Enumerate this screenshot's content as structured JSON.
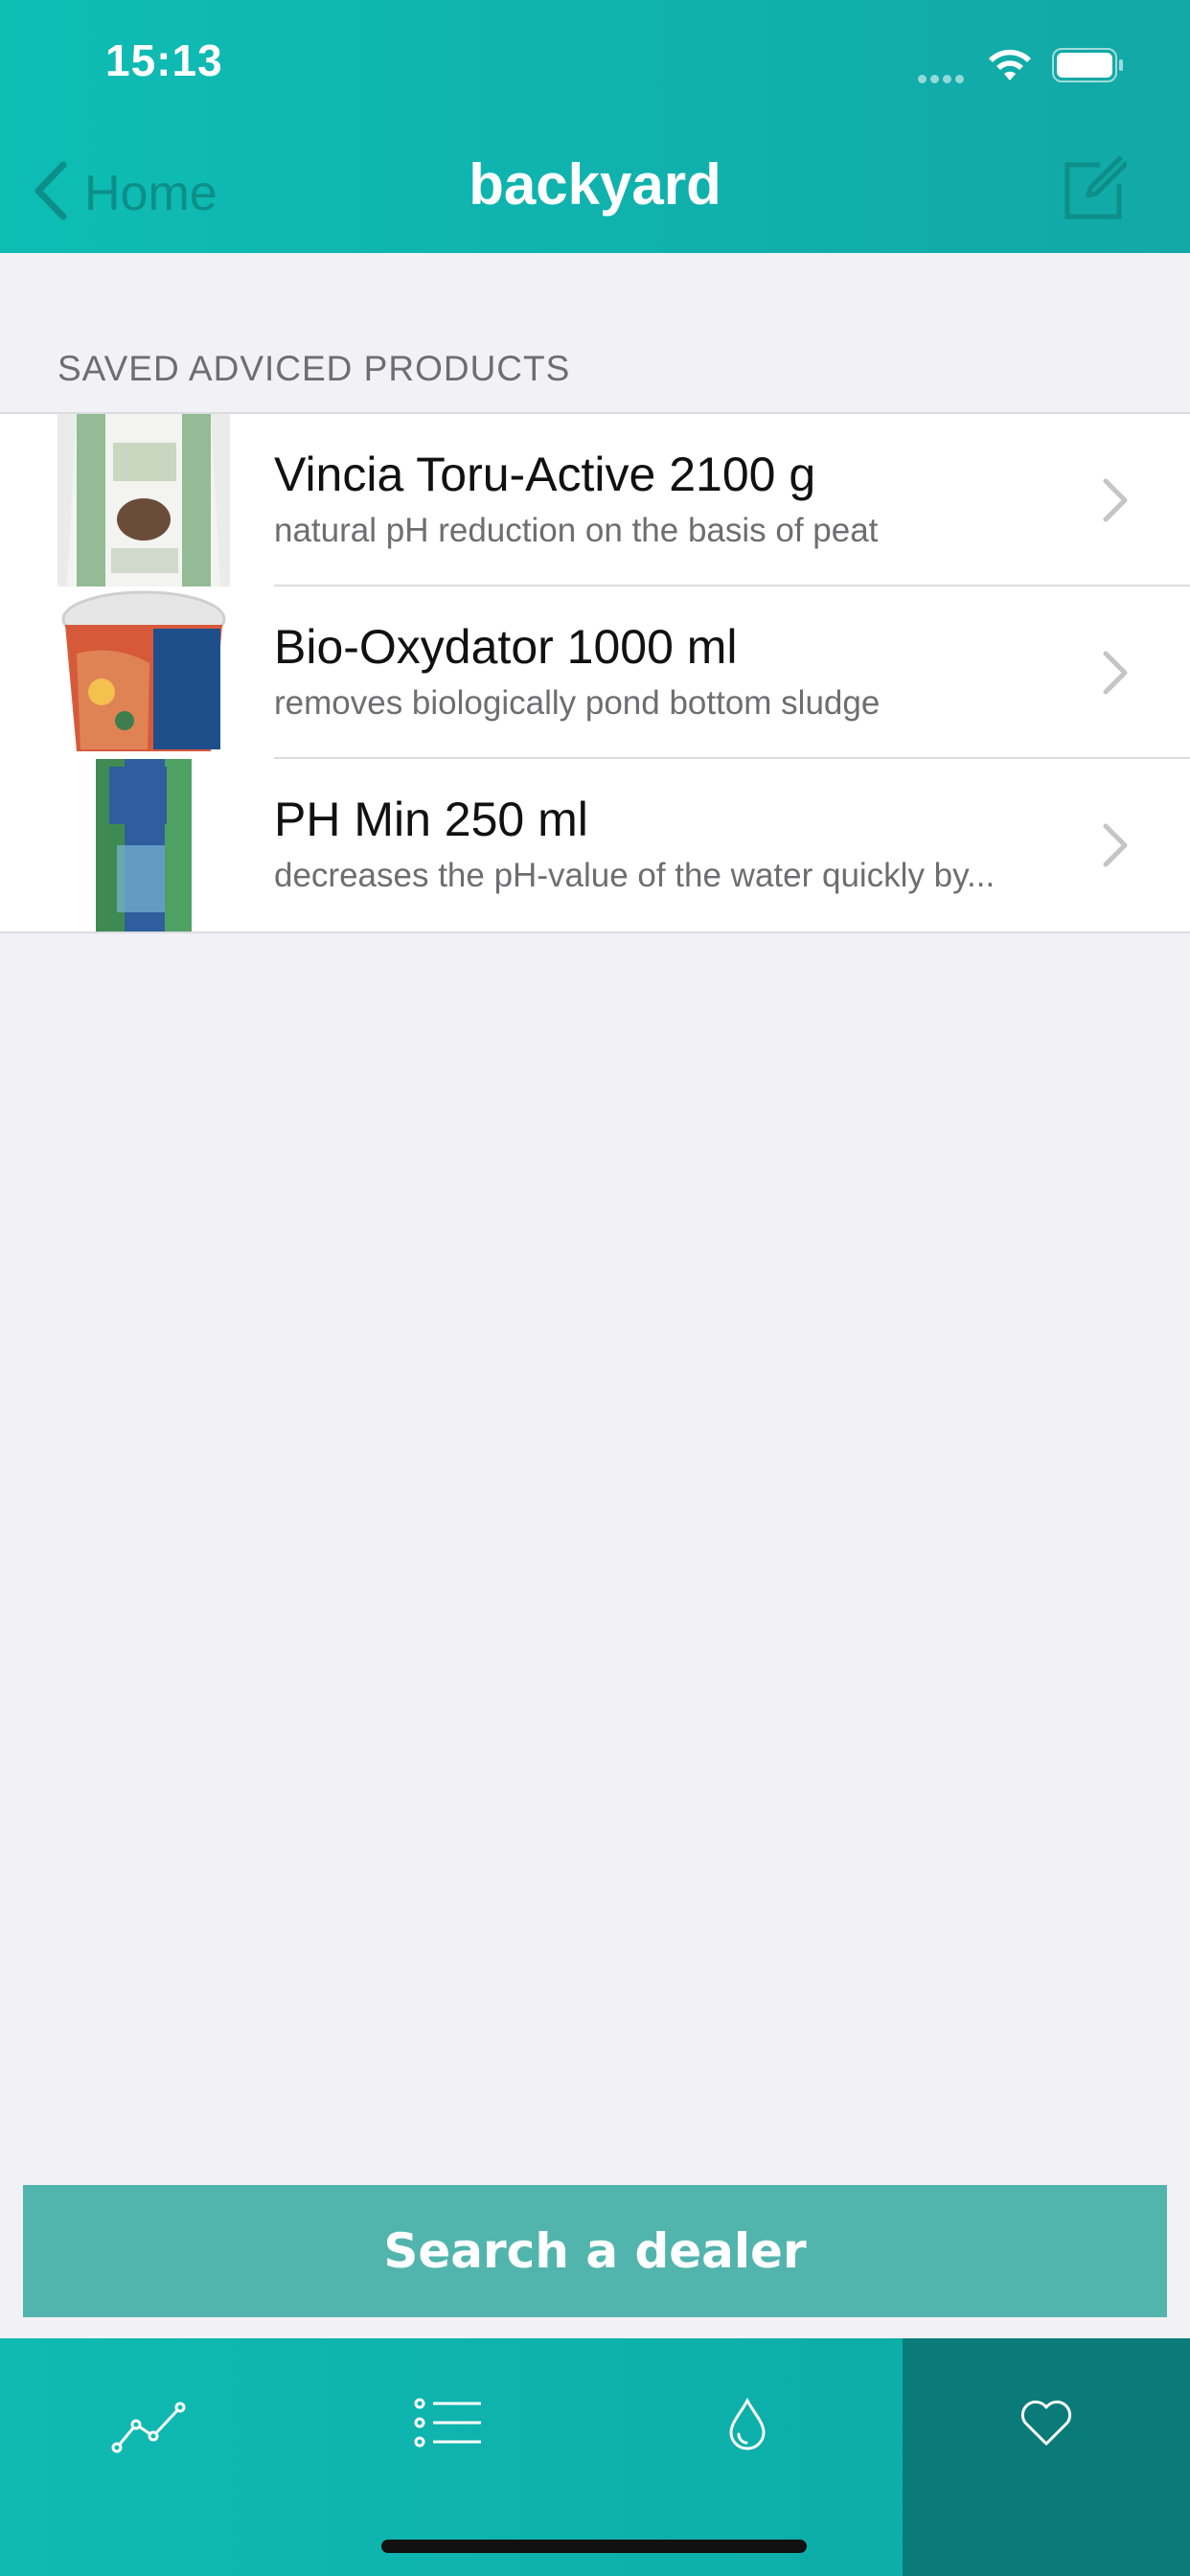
{
  "status_bar": {
    "time": "15:13"
  },
  "nav": {
    "back_label": "Home",
    "title": "backyard"
  },
  "section": {
    "header": "SAVED ADVICED PRODUCTS"
  },
  "products": [
    {
      "title": "Vincia Toru-Active 2100 g",
      "subtitle": "natural pH reduction on the basis of peat"
    },
    {
      "title": "Bio-Oxydator 1000 ml",
      "subtitle": "removes biologically pond bottom sludge"
    },
    {
      "title": "PH Min 250 ml",
      "subtitle": "decreases the pH-value of the water quickly by..."
    }
  ],
  "dealer_button": {
    "label": "Search a dealer"
  },
  "tabs": [
    {
      "icon": "chart-line-icon",
      "active": false
    },
    {
      "icon": "list-icon",
      "active": false
    },
    {
      "icon": "water-drop-icon",
      "active": false
    },
    {
      "icon": "heart-icon",
      "active": true
    }
  ],
  "colors": {
    "header": "#0dbdb4",
    "accent": "#52b5ad",
    "active_tab": "#0a7b78"
  }
}
